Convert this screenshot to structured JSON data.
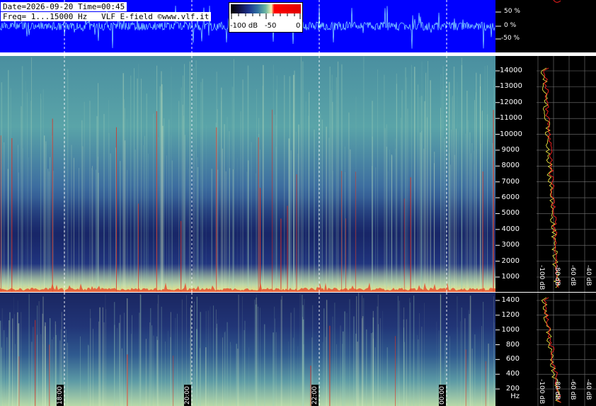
{
  "header": {
    "line1": "Date=2026-09-20 Time=00:45",
    "line2": "Freq= 1...15000 Hz   VLF E-field ©www.vlf.it"
  },
  "legend": {
    "labels": [
      "-100 dB",
      "-50",
      "0"
    ]
  },
  "wave_scale": {
    "labels": [
      "50 %",
      "0 %",
      "-50 %"
    ]
  },
  "freq_axis_hi": {
    "ticks": [
      "14000",
      "13000",
      "12000",
      "11000",
      "10000",
      "9000",
      "8000",
      "7000",
      "6000",
      "5000",
      "4000",
      "3000",
      "2000",
      "1000"
    ],
    "db_labels": [
      "-100 dB",
      "-80 dB",
      "-60 dB",
      "-40 dB",
      "-20 dB"
    ]
  },
  "freq_axis_lo": {
    "ticks": [
      "1400",
      "1200",
      "1000",
      "800",
      "600",
      "400",
      "200 Hz"
    ],
    "db_labels": [
      "-100 dB",
      "-80 dB",
      "-60 dB",
      "-40 dB",
      "-20 dB"
    ]
  },
  "time_labels": [
    "18:00",
    "20:00",
    "22:00",
    "00:00"
  ],
  "colors": {
    "wave_bg": "#0000ff",
    "axis_bg": "#000000",
    "trace_red": "#ff2020",
    "trace_yellow": "#e8e040"
  }
}
